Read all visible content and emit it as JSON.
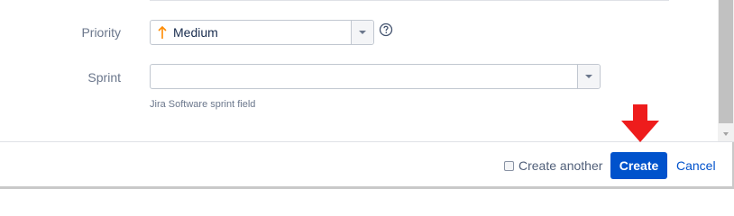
{
  "form": {
    "priority": {
      "label": "Priority",
      "value": "Medium",
      "value_icon": "arrow-up-icon",
      "value_icon_color": "#ff8b00",
      "help_icon": "question-circle-icon"
    },
    "sprint": {
      "label": "Sprint",
      "value": "",
      "description": "Jira Software sprint field"
    }
  },
  "footer": {
    "create_another_label": "Create another",
    "create_another_checked": false,
    "create_label": "Create",
    "cancel_label": "Cancel"
  },
  "annotation": {
    "icon": "red-down-arrow-icon",
    "color": "#ee1c1c"
  },
  "colors": {
    "primary": "#0052cc",
    "label": "#6b778c"
  }
}
